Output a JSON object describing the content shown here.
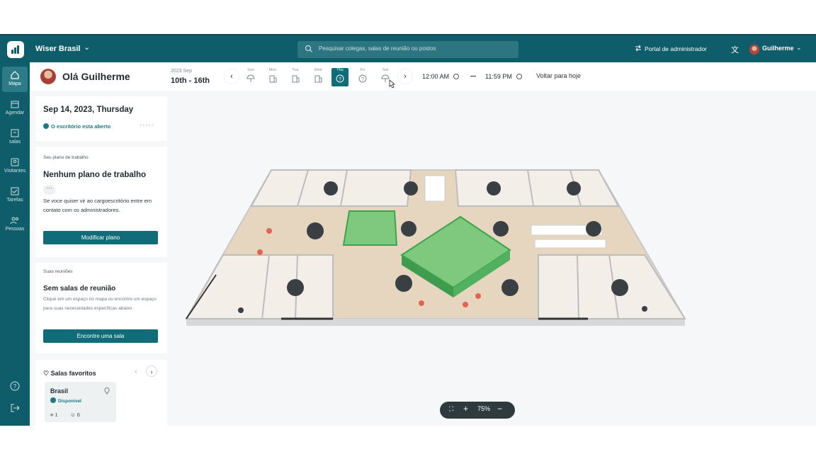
{
  "topbar": {
    "org_name": "Wiser Brasil",
    "search_placeholder": "Pesquisar colegas, salas de reunião ou postos",
    "admin_portal": "Portal de administrador",
    "user_name": "Guilherme"
  },
  "rail": {
    "items": [
      {
        "label": "Mapa",
        "icon": "home-icon"
      },
      {
        "label": "Agendar",
        "icon": "calendar-icon"
      },
      {
        "label": "salas",
        "icon": "rooms-icon"
      },
      {
        "label": "Visitantes",
        "icon": "visitor-badge-icon"
      },
      {
        "label": "Tarefas",
        "icon": "tasks-icon"
      },
      {
        "label": "Pessoas",
        "icon": "people-icon"
      }
    ]
  },
  "header": {
    "greeting": "Olá Guilherme",
    "week_year": "2023 Sep",
    "week_range": "10th - 16th",
    "days": [
      "Sun",
      "Mon",
      "Tue",
      "Wed",
      "Thu",
      "Fri",
      "Sat"
    ],
    "start_time": "12:00 AM",
    "end_time": "11:59 PM",
    "back_today": "Voltar para hoje"
  },
  "day_card": {
    "date": "Sep 14, 2023, Thursday",
    "status": "O escritório esta aberto"
  },
  "plan_card": {
    "label": "Seu plano de trabalho",
    "title": "Nenhum plano de trabalho",
    "more": "···",
    "text": "Se voce quiser vir ao cargoescritório entre em contato com os administradores.",
    "button": "Modificar plano"
  },
  "meetings_card": {
    "label": "Suas reuniões",
    "title": "Sem salas de reunião",
    "text": "Clique em um espaço no mapa ou encontre um espaço para suas necessidades específicas abaixo",
    "button": "Encontre uma sala"
  },
  "favorites": {
    "title": "Salas favoritos",
    "room_name": "Brasil",
    "room_status": "Disponível",
    "floors": "1",
    "capacity": "6"
  },
  "zoom": {
    "level": "75%"
  },
  "colors": {
    "primary": "#0f5d6b",
    "button": "#0f6c78",
    "room_highlight": "#5cc46a",
    "floor": "#e7d6bf"
  }
}
